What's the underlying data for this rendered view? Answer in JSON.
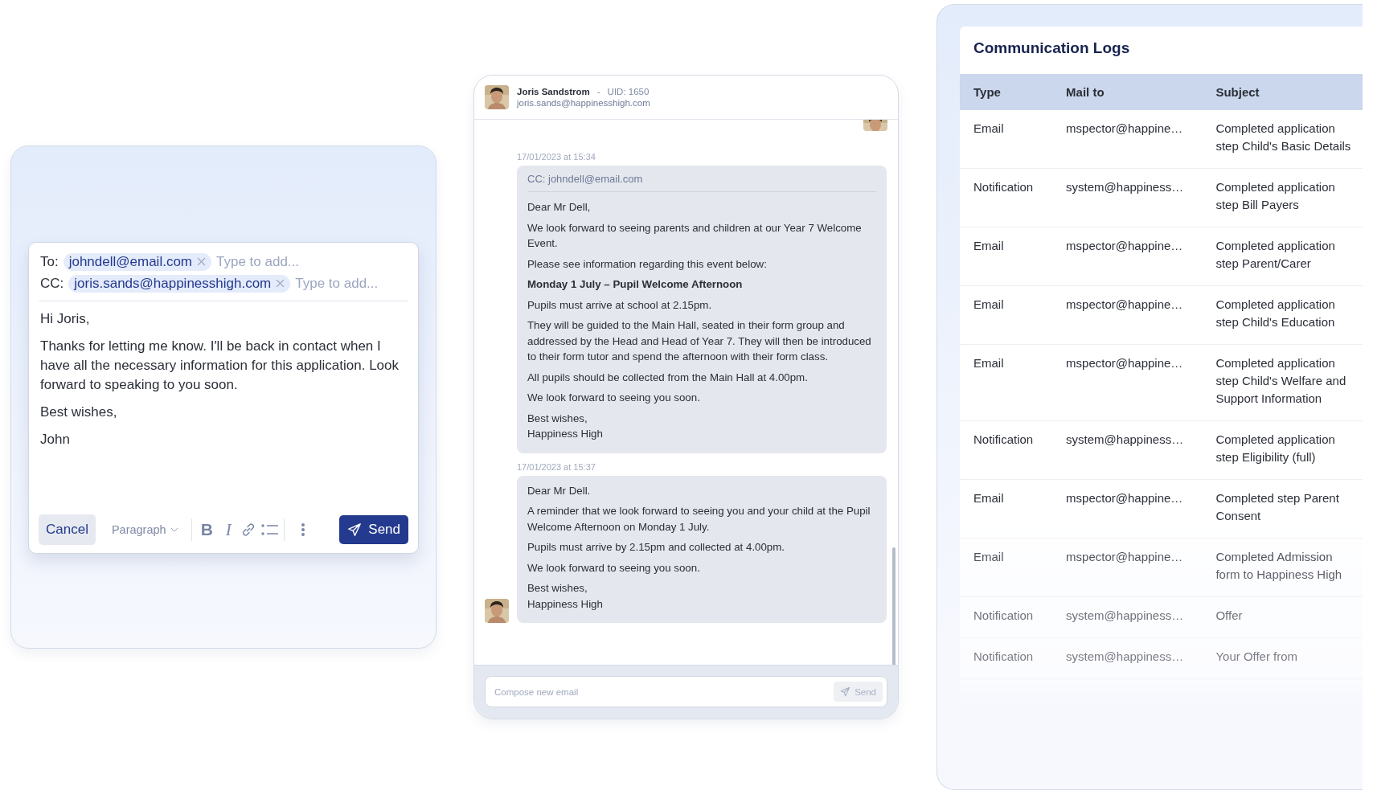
{
  "composer": {
    "to_label": "To:",
    "to_recipients": [
      "johndell@email.com"
    ],
    "to_placeholder": "Type to add...",
    "cc_label": "CC:",
    "cc_recipients": [
      "joris.sands@happinesshigh.com"
    ],
    "cc_placeholder": "Type to add...",
    "body": [
      "Hi Joris,",
      "Thanks for letting me know. I'll be back in contact when I have all the necessary information for this application. Look forward to speaking to you soon.",
      "Best wishes,",
      "John"
    ],
    "cancel": "Cancel",
    "format": "Paragraph",
    "tools": [
      {
        "kind": "bold",
        "glyph": "B"
      },
      {
        "kind": "italic",
        "glyph": "I"
      },
      {
        "kind": "link"
      },
      {
        "kind": "list"
      },
      {
        "kind": "more"
      }
    ],
    "send": "Send"
  },
  "thread": {
    "contact": {
      "name": "Joris Sandstrom",
      "separator": "-",
      "uid": "UID: 1650",
      "email": "joris.sands@happinesshigh.com"
    },
    "messages": [
      {
        "timestamp": "17/01/2023 at 15:34",
        "cc": "CC: johndell@email.com",
        "sender_avatar": false,
        "paragraphs": [
          {
            "kind": "text",
            "text": "Dear Mr Dell,"
          },
          {
            "kind": "text",
            "text": "We look forward to seeing parents and children at our Year 7 Welcome Event."
          },
          {
            "kind": "text",
            "text": "Please see information regarding this event below:"
          },
          {
            "kind": "heading",
            "text": "Monday 1 July – Pupil Welcome Afternoon"
          },
          {
            "kind": "text",
            "text": "Pupils must arrive at school at 2.15pm."
          },
          {
            "kind": "text",
            "text": "They will be guided to the Main Hall, seated in their form group and addressed by the Head and Head of Year 7. They will then be introduced to their form tutor and spend the afternoon with their form class."
          },
          {
            "kind": "text",
            "text": "All pupils should be collected from the Main Hall at 4.00pm."
          },
          {
            "kind": "text",
            "text": "We look forward to seeing you soon."
          },
          {
            "kind": "text",
            "text": "Best wishes,\nHappiness High"
          }
        ]
      },
      {
        "timestamp": "17/01/2023 at 15:37",
        "sender_avatar": true,
        "paragraphs": [
          {
            "kind": "text",
            "text": "Dear Mr Dell."
          },
          {
            "kind": "text",
            "text": "A reminder that we look forward to seeing you and your child at the Pupil Welcome Afternoon on Monday 1 July."
          },
          {
            "kind": "text",
            "text": "Pupils must arrive by 2.15pm and collected at 4.00pm."
          },
          {
            "kind": "text",
            "text": "We look forward to seeing you soon."
          },
          {
            "kind": "text",
            "text": "Best wishes,\nHappiness High"
          }
        ]
      }
    ],
    "compose": {
      "placeholder": "Compose new email",
      "send": "Send"
    }
  },
  "logs": {
    "title": "Communication Logs",
    "columns": [
      "Type",
      "Mail to",
      "Subject"
    ],
    "rows": [
      {
        "type": "Email",
        "mail_to": "mspector@happine…",
        "subject": "Completed application step Child's Basic Details"
      },
      {
        "type": "Notification",
        "mail_to": "system@happiness…",
        "subject": "Completed application step Bill Payers"
      },
      {
        "type": "Email",
        "mail_to": "mspector@happine…",
        "subject": "Completed application step Parent/Carer"
      },
      {
        "type": "Email",
        "mail_to": "mspector@happine…",
        "subject": "Completed application step Child's Education"
      },
      {
        "type": "Email",
        "mail_to": "mspector@happine…",
        "subject": "Completed application step Child's Welfare and Support Information"
      },
      {
        "type": "Notification",
        "mail_to": "system@happiness…",
        "subject": "Completed application step Eligibility (full)"
      },
      {
        "type": "Email",
        "mail_to": "mspector@happine…",
        "subject": "Completed step Parent Consent"
      },
      {
        "type": "Email",
        "mail_to": "mspector@happine…",
        "subject": "Completed Admission form to Happiness High"
      },
      {
        "type": "Notification",
        "mail_to": "system@happiness…",
        "subject": "Offer"
      },
      {
        "type": "Notification",
        "mail_to": "system@happiness…",
        "subject": "Your Offer from"
      }
    ]
  }
}
